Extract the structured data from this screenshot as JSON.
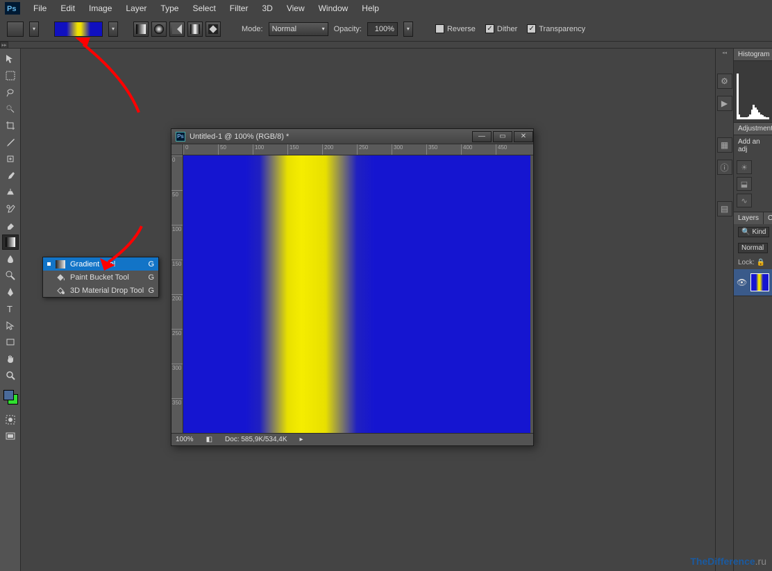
{
  "app": {
    "logo": "Ps"
  },
  "menu": [
    "File",
    "Edit",
    "Image",
    "Layer",
    "Type",
    "Select",
    "Filter",
    "3D",
    "View",
    "Window",
    "Help"
  ],
  "options": {
    "mode_label": "Mode:",
    "mode_value": "Normal",
    "opacity_label": "Opacity:",
    "opacity_value": "100%",
    "reverse": "Reverse",
    "dither": "Dither",
    "transparency": "Transparency"
  },
  "flyout": {
    "items": [
      {
        "label": "Gradient Tool",
        "key": "G"
      },
      {
        "label": "Paint Bucket Tool",
        "key": "G"
      },
      {
        "label": "3D Material Drop Tool",
        "key": "G"
      }
    ]
  },
  "doc": {
    "title": "Untitled-1 @ 100% (RGB/8) *",
    "ruler_h": [
      "0",
      "50",
      "100",
      "150",
      "200",
      "250",
      "300",
      "350",
      "400",
      "450"
    ],
    "ruler_v": [
      "0",
      "50",
      "100",
      "150",
      "200",
      "250",
      "300",
      "350"
    ],
    "zoom": "100%",
    "docinfo": "Doc: 585,9K/534,4K"
  },
  "panels": {
    "histogram": "Histogram",
    "adjustments": "Adjustments",
    "add_adj_text": "Add an adj",
    "layers": "Layers",
    "channels_short": "Ch",
    "kind": "Kind",
    "blend": "Normal",
    "lock": "Lock:"
  },
  "watermark": {
    "brand": "TheDifference",
    "suffix": ".ru"
  }
}
